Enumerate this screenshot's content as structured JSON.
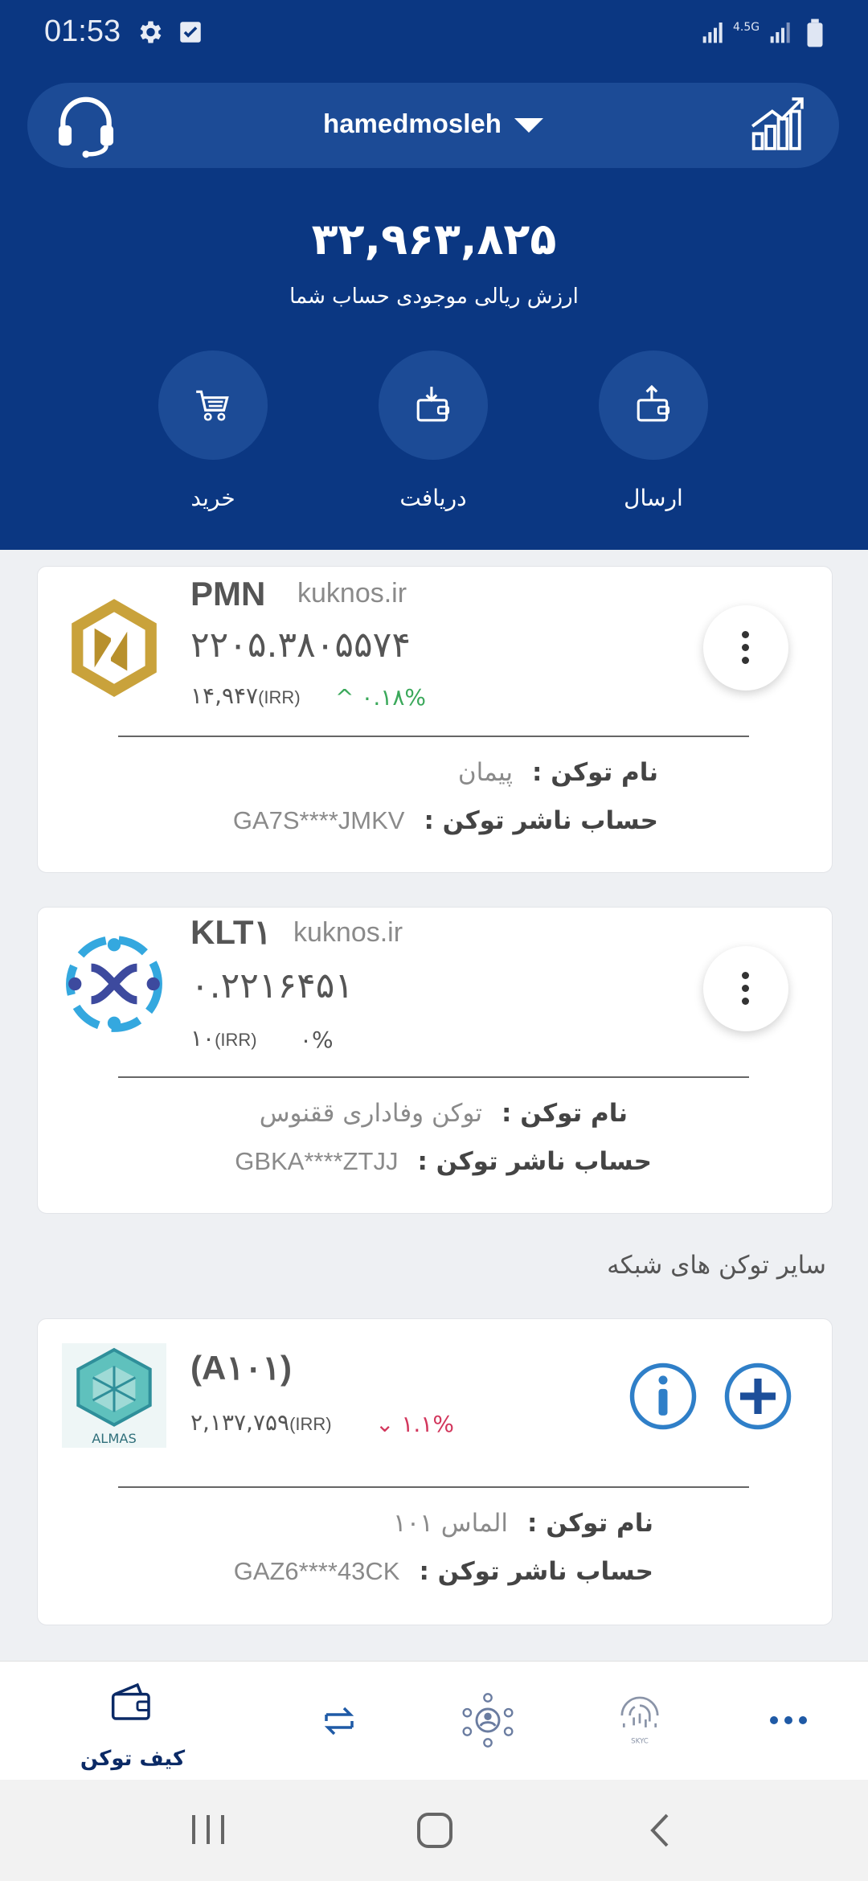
{
  "status_bar": {
    "time": "01:53",
    "network": "4.5G"
  },
  "header": {
    "account": "hamedmosleh",
    "balance": "۳۲,۹۶۳,۸۲۵",
    "balance_label": "ارزش ریالی موجودی حساب شما",
    "actions": [
      {
        "label": "خرید",
        "icon": "cart-icon"
      },
      {
        "label": "دریافت",
        "icon": "receive-wallet-icon"
      },
      {
        "label": "ارسال",
        "icon": "send-wallet-icon"
      }
    ]
  },
  "tokens": [
    {
      "symbol": "PMN",
      "domain": "kuknos.ir",
      "amount": "۲۲۰۵.۳۸۰۵۵۷۴",
      "price": "۱۴,۹۴۷",
      "currency": "(IRR)",
      "change": "^ ۰.۱۸%",
      "name_label": "نام توکن :",
      "name": "پیمان",
      "issuer_label": "حساب ناشر توکن :",
      "issuer": "GA7S****JMKV"
    },
    {
      "symbol": "KLT۱",
      "domain": "kuknos.ir",
      "amount": "۰.۲۲۱۶۴۵۱",
      "price": "۱۰",
      "currency": "(IRR)",
      "change": "۰%",
      "name_label": "نام توکن :",
      "name": "توکن وفاداری ققنوس",
      "issuer_label": "حساب ناشر توکن :",
      "issuer": "GBKA****ZTJJ"
    }
  ],
  "other_section_title": "سایر توکن های شبکه",
  "other_tokens": [
    {
      "symbol": "(A۱۰۱)",
      "logo_text": "ALMAS",
      "price": "۲,۱۳۷,۷۵۹",
      "currency": "(IRR)",
      "change": "⌄ ۱.۱%",
      "name_label": "نام توکن :",
      "name": "الماس ۱۰۱",
      "issuer_label": "حساب ناشر توکن :",
      "issuer": "GAZ6****43CK"
    }
  ],
  "bottom_nav": {
    "wallet_label": "کیف توکن"
  },
  "colors": {
    "primary": "#0b3782",
    "primary_light": "#1c4b96",
    "positive": "#3aa85a",
    "negative": "#d2365c"
  }
}
